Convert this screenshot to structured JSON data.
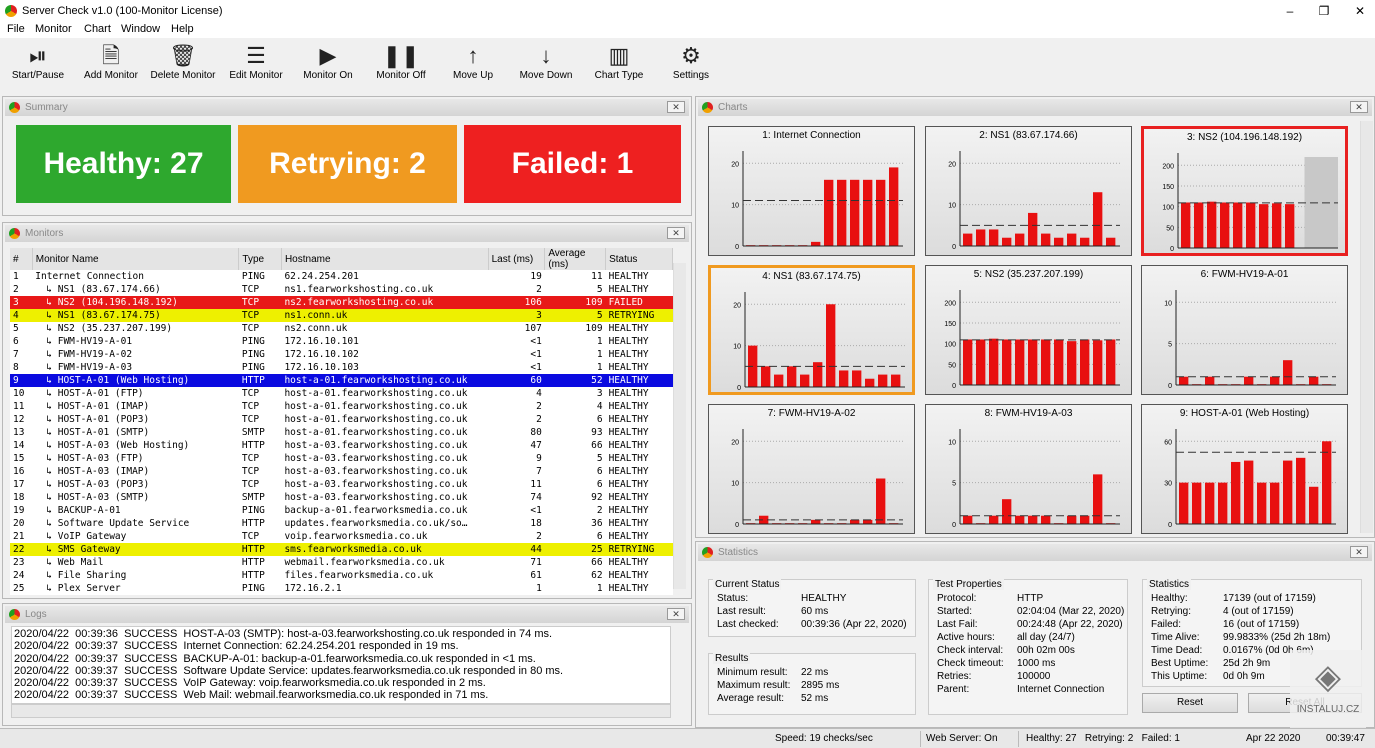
{
  "window": {
    "title": "Server Check v1.0 (100-Monitor License)"
  },
  "menu": [
    "File",
    "Monitor",
    "Chart",
    "Window",
    "Help"
  ],
  "toolbar": [
    {
      "label": "Start/Pause",
      "icon": "play-pause-icon",
      "glyph": "⏯"
    },
    {
      "label": "Add Monitor",
      "icon": "add-document-icon",
      "glyph": "🗎"
    },
    {
      "label": "Delete Monitor",
      "icon": "trash-icon",
      "glyph": "🗑"
    },
    {
      "label": "Edit Monitor",
      "icon": "list-icon",
      "glyph": "☰"
    },
    {
      "label": "Monitor On",
      "icon": "play-icon",
      "glyph": "▶"
    },
    {
      "label": "Monitor Off",
      "icon": "pause-icon",
      "glyph": "❚❚"
    },
    {
      "label": "Move Up",
      "icon": "arrow-up-icon",
      "glyph": "↑"
    },
    {
      "label": "Move Down",
      "icon": "arrow-down-icon",
      "glyph": "↓"
    },
    {
      "label": "Chart Type",
      "icon": "bar-chart-icon",
      "glyph": "▥"
    },
    {
      "label": "Settings",
      "icon": "gear-icon",
      "glyph": "⚙"
    }
  ],
  "summary": {
    "title": "Summary",
    "healthy": "Healthy: 27",
    "retrying": "Retrying: 2",
    "failed": "Failed: 1",
    "colors": {
      "healthy": "#2ea82e",
      "retrying": "#f09a20",
      "failed": "#ee2020"
    }
  },
  "monitors": {
    "title": "Monitors",
    "columns": [
      "#",
      "Monitor Name",
      "Type",
      "Hostname",
      "Last (ms)",
      "Average (ms)",
      "Status"
    ],
    "rows": [
      [
        "1",
        "Internet Connection",
        "PING",
        "62.24.254.201",
        "19",
        "11",
        "HEALTHY"
      ],
      [
        "2",
        "↳ NS1 (83.67.174.66)",
        "TCP",
        "ns1.fearworkshosting.co.uk",
        "2",
        "5",
        "HEALTHY"
      ],
      [
        "3",
        "↳ NS2 (104.196.148.192)",
        "TCP",
        "ns2.fearworkshosting.co.uk",
        "106",
        "109",
        "FAILED"
      ],
      [
        "4",
        "↳ NS1 (83.67.174.75)",
        "TCP",
        "ns1.conn.uk",
        "3",
        "5",
        "RETRYING"
      ],
      [
        "5",
        "↳ NS2 (35.237.207.199)",
        "TCP",
        "ns2.conn.uk",
        "107",
        "109",
        "HEALTHY"
      ],
      [
        "6",
        "↳ FWM-HV19-A-01",
        "PING",
        "172.16.10.101",
        "<1",
        "1",
        "HEALTHY"
      ],
      [
        "7",
        "↳ FWM-HV19-A-02",
        "PING",
        "172.16.10.102",
        "<1",
        "1",
        "HEALTHY"
      ],
      [
        "8",
        "↳ FWM-HV19-A-03",
        "PING",
        "172.16.10.103",
        "<1",
        "1",
        "HEALTHY"
      ],
      [
        "9",
        "↳ HOST-A-01 (Web Hosting)",
        "HTTP",
        "host-a-01.fearworkshosting.co.uk",
        "60",
        "52",
        "HEALTHY"
      ],
      [
        "10",
        "↳ HOST-A-01 (FTP)",
        "TCP",
        "host-a-01.fearworkshosting.co.uk",
        "4",
        "3",
        "HEALTHY"
      ],
      [
        "11",
        "↳ HOST-A-01 (IMAP)",
        "TCP",
        "host-a-01.fearworkshosting.co.uk",
        "2",
        "4",
        "HEALTHY"
      ],
      [
        "12",
        "↳ HOST-A-01 (POP3)",
        "TCP",
        "host-a-01.fearworkshosting.co.uk",
        "2",
        "6",
        "HEALTHY"
      ],
      [
        "13",
        "↳ HOST-A-01 (SMTP)",
        "SMTP",
        "host-a-01.fearworkshosting.co.uk",
        "80",
        "93",
        "HEALTHY"
      ],
      [
        "14",
        "↳ HOST-A-03 (Web Hosting)",
        "HTTP",
        "host-a-03.fearworkshosting.co.uk",
        "47",
        "66",
        "HEALTHY"
      ],
      [
        "15",
        "↳ HOST-A-03 (FTP)",
        "TCP",
        "host-a-03.fearworkshosting.co.uk",
        "9",
        "5",
        "HEALTHY"
      ],
      [
        "16",
        "↳ HOST-A-03 (IMAP)",
        "TCP",
        "host-a-03.fearworkshosting.co.uk",
        "7",
        "6",
        "HEALTHY"
      ],
      [
        "17",
        "↳ HOST-A-03 (POP3)",
        "TCP",
        "host-a-03.fearworkshosting.co.uk",
        "11",
        "6",
        "HEALTHY"
      ],
      [
        "18",
        "↳ HOST-A-03 (SMTP)",
        "SMTP",
        "host-a-03.fearworkshosting.co.uk",
        "74",
        "92",
        "HEALTHY"
      ],
      [
        "19",
        "↳ BACKUP-A-01",
        "PING",
        "backup-a-01.fearworksmedia.co.uk",
        "<1",
        "2",
        "HEALTHY"
      ],
      [
        "20",
        "↳ Software Update Service",
        "HTTP",
        "updates.fearworksmedia.co.uk/so…",
        "18",
        "36",
        "HEALTHY"
      ],
      [
        "21",
        "↳ VoIP Gateway",
        "TCP",
        "voip.fearworksmedia.co.uk",
        "2",
        "6",
        "HEALTHY"
      ],
      [
        "22",
        "↳ SMS Gateway",
        "HTTP",
        "sms.fearworksmedia.co.uk",
        "44",
        "25",
        "RETRYING"
      ],
      [
        "23",
        "↳ Web Mail",
        "HTTP",
        "webmail.fearworksmedia.co.uk",
        "71",
        "66",
        "HEALTHY"
      ],
      [
        "24",
        "↳ File Sharing",
        "HTTP",
        "files.fearworksmedia.co.uk",
        "61",
        "62",
        "HEALTHY"
      ],
      [
        "25",
        "↳ Plex Server",
        "PING",
        "172.16.2.1",
        "1",
        "1",
        "HEALTHY"
      ]
    ],
    "row_colors": {
      "FAILED": "#e81818",
      "RETRYING": "#eef000",
      "SELECTED": "#0a0ae0"
    },
    "selected_row": "9"
  },
  "logs": {
    "title": "Logs",
    "lines": [
      "2020/04/22  00:39:36  SUCCESS  HOST-A-03 (SMTP): host-a-03.fearworkshosting.co.uk responded in 74 ms.",
      "2020/04/22  00:39:37  SUCCESS  Internet Connection: 62.24.254.201 responded in 19 ms.",
      "2020/04/22  00:39:37  SUCCESS  BACKUP-A-01: backup-a-01.fearworksmedia.co.uk responded in <1 ms.",
      "2020/04/22  00:39:37  SUCCESS  Software Update Service: updates.fearworksmedia.co.uk responded in 80 ms.",
      "2020/04/22  00:39:37  SUCCESS  VoIP Gateway: voip.fearworksmedia.co.uk responded in 2 ms.",
      "2020/04/22  00:39:37  SUCCESS  Web Mail: webmail.fearworksmedia.co.uk responded in 71 ms."
    ]
  },
  "charts": {
    "title": "Charts",
    "bar_color": "#e81010",
    "failed_bar_color": "#c8c8c8"
  },
  "chart_data": [
    {
      "type": "bar",
      "title": "1: Internet Connection",
      "yticks": [
        0,
        10,
        20
      ],
      "ylim": [
        0,
        22
      ],
      "average": 11,
      "values": [
        0.2,
        0.2,
        0.2,
        0.2,
        0.2,
        1,
        16,
        16,
        16,
        16,
        16,
        19
      ]
    },
    {
      "type": "bar",
      "title": "2: NS1 (83.67.174.66)",
      "yticks": [
        0,
        10,
        20
      ],
      "ylim": [
        0,
        22
      ],
      "average": 5,
      "values": [
        3,
        4,
        4,
        2,
        3,
        8,
        3,
        2,
        3,
        2,
        13,
        2
      ]
    },
    {
      "type": "bar",
      "title": "3: NS2 (104.196.148.192)",
      "yticks": [
        0,
        50,
        100,
        150,
        200
      ],
      "ylim": [
        0,
        220
      ],
      "average": 109,
      "values": [
        110,
        110,
        112,
        110,
        110,
        110,
        106,
        108,
        106
      ],
      "failed_values": [
        220
      ],
      "highlight": "failed"
    },
    {
      "type": "bar",
      "title": "4: NS1 (83.67.174.75)",
      "yticks": [
        0,
        10,
        20
      ],
      "ylim": [
        0,
        22
      ],
      "average": 5,
      "values": [
        10,
        5,
        3,
        5,
        3,
        6,
        20,
        4,
        4,
        2,
        3,
        3
      ],
      "highlight": "retrying"
    },
    {
      "type": "bar",
      "title": "5: NS2 (35.237.207.199)",
      "yticks": [
        0,
        50,
        100,
        150,
        200
      ],
      "ylim": [
        0,
        220
      ],
      "average": 109,
      "values": [
        110,
        110,
        112,
        110,
        110,
        110,
        110,
        110,
        106,
        110,
        108,
        110
      ]
    },
    {
      "type": "bar",
      "title": "6: FWM-HV19-A-01",
      "yticks": [
        0,
        5,
        10
      ],
      "ylim": [
        0,
        11
      ],
      "average": 1,
      "values": [
        1,
        0.1,
        1,
        0.1,
        0.1,
        1,
        0.1,
        1,
        3,
        0.1,
        1,
        0.1
      ]
    },
    {
      "type": "bar",
      "title": "7: FWM-HV19-A-02",
      "yticks": [
        0,
        10,
        20
      ],
      "ylim": [
        0,
        22
      ],
      "average": 1,
      "values": [
        0.2,
        2,
        0.2,
        0.2,
        0.2,
        1,
        0.2,
        0.2,
        1,
        1,
        11,
        0.2
      ]
    },
    {
      "type": "bar",
      "title": "8: FWM-HV19-A-03",
      "yticks": [
        0,
        5,
        10
      ],
      "ylim": [
        0,
        11
      ],
      "average": 1,
      "values": [
        1,
        0.1,
        1,
        3,
        1,
        1,
        1,
        0.1,
        1,
        1,
        6,
        0.1
      ]
    },
    {
      "type": "bar",
      "title": "9: HOST-A-01 (Web Hosting)",
      "yticks": [
        0,
        30,
        60
      ],
      "ylim": [
        0,
        66
      ],
      "average": 52,
      "values": [
        30,
        30,
        30,
        30,
        45,
        46,
        30,
        30,
        46,
        48,
        27,
        60
      ]
    }
  ],
  "statistics": {
    "title": "Statistics",
    "current_status": {
      "title": "Current Status",
      "items": [
        [
          "Status:",
          "HEALTHY"
        ],
        [
          "Last result:",
          "60 ms"
        ],
        [
          "Last checked:",
          "00:39:36 (Apr 22, 2020)"
        ]
      ]
    },
    "results": {
      "title": "Results",
      "items": [
        [
          "Minimum result:",
          "22 ms"
        ],
        [
          "Maximum result:",
          "2895 ms"
        ],
        [
          "Average result:",
          "52 ms"
        ]
      ]
    },
    "test_properties": {
      "title": "Test Properties",
      "items": [
        [
          "Protocol:",
          "HTTP"
        ],
        [
          "Started:",
          "02:04:04 (Mar 22, 2020)"
        ],
        [
          "Last Fail:",
          "00:24:48 (Apr 22, 2020)"
        ],
        [
          "Active hours:",
          "all day (24/7)"
        ],
        [
          "Check interval:",
          "00h 02m 00s"
        ],
        [
          "Check timeout:",
          "1000 ms"
        ],
        [
          "Retries:",
          "100000"
        ],
        [
          "Parent:",
          "Internet Connection"
        ]
      ]
    },
    "stats": {
      "title": "Statistics",
      "items": [
        [
          "Healthy:",
          "17139 (out of 17159)"
        ],
        [
          "Retrying:",
          "4 (out of 17159)"
        ],
        [
          "Failed:",
          "16 (out of 17159)"
        ],
        [
          "Time Alive:",
          "99.9833% (25d 2h 18m)"
        ],
        [
          "Time Dead:",
          "0.0167% (0d 0h 6m)"
        ],
        [
          "Best Uptime:",
          "25d 2h 9m"
        ],
        [
          "This Uptime:",
          "0d 0h 9m"
        ]
      ]
    },
    "reset": "Reset",
    "reset_all": "Reset All"
  },
  "statusbar": {
    "speed": "Speed: 19 checks/sec",
    "web_server": "Web Server: On",
    "counts": "Healthy: 27   Retrying: 2   Failed: 1",
    "date": "Apr 22 2020",
    "time": "00:39:47"
  },
  "watermark": "INSTALUJ.CZ"
}
